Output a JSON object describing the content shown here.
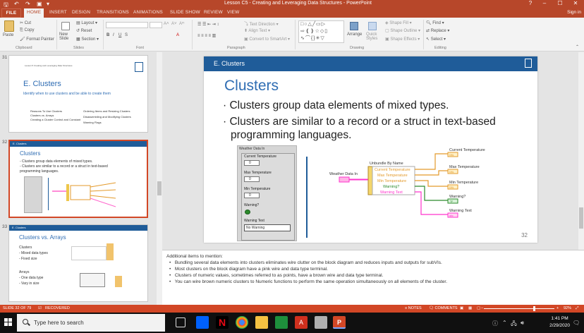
{
  "window": {
    "title": "Lesson C5 - Creating and Leveraging Data Structures - PowerPoint",
    "sign_in": "Sign in",
    "minimize": "–",
    "restore": "☐",
    "close": "✕",
    "help": "?"
  },
  "tabs": [
    "FILE",
    "HOME",
    "INSERT",
    "DESIGN",
    "TRANSITIONS",
    "ANIMATIONS",
    "SLIDE SHOW",
    "REVIEW",
    "VIEW"
  ],
  "ribbon": {
    "clipboard": {
      "paste": "Paste",
      "cut": "Cut",
      "copy": "Copy",
      "format_painter": "Format Painter",
      "label": "Clipboard"
    },
    "slides": {
      "new_slide": "New Slide",
      "layout": "Layout",
      "reset": "Reset",
      "section": "Section",
      "label": "Slides"
    },
    "font": {
      "label": "Font",
      "bold": "B",
      "italic": "I",
      "underline": "U",
      "strike": "S",
      "grow": "A˄",
      "shrink": "A˅",
      "clear": "Aᵐ",
      "color": "A"
    },
    "paragraph": {
      "text_direction": "Text Direction",
      "align_text": "Align Text",
      "smartart": "Convert to SmartArt",
      "label": "Paragraph"
    },
    "drawing": {
      "arrange": "Arrange",
      "quick_styles": "Quick Styles",
      "shape_fill": "Shape Fill",
      "shape_outline": "Shape Outline",
      "shape_effects": "Shape Effects",
      "label": "Drawing"
    },
    "editing": {
      "find": "Find",
      "replace": "Replace",
      "select": "Select",
      "label": "Editing"
    }
  },
  "thumbnails": [
    {
      "number": "31",
      "title": "E. Clusters",
      "subtitle": "Identify when to use clusters and be able to create them",
      "header": "Lesson 5 Creating and Leveraging Data Structures",
      "col1": [
        "Reasons To Use Clusters",
        "Clusters vs. Arrays",
        "Creating a Cluster Control and Constant"
      ],
      "col2": [
        "Ordering Items and Resizing Clusters",
        "Disassembling and Modifying Clusters",
        "Warning Flags"
      ]
    },
    {
      "number": "32",
      "bar": "E. Clusters",
      "title": "Clusters",
      "lines": [
        "- Clusters group data elements of mixed types.",
        "- Clusters are similar to a record or a struct in text-based",
        "  programming languages."
      ]
    },
    {
      "number": "33",
      "bar": "E. Clusters",
      "title": "Clusters vs. Arrays",
      "lines": [
        "Clusters",
        "- Mixed data types",
        "- Fixed size",
        "Arrays",
        "- One data type",
        "- Vary in size"
      ]
    }
  ],
  "slide": {
    "section_bar": "E. Clusters",
    "title": "Clusters",
    "bullets": [
      "Clusters group data elements of mixed types.",
      "Clusters are similar to a record or a struct in text-based programming languages."
    ],
    "page_number": "32",
    "front_panel": {
      "title": "Weather Data In",
      "current_temp_label": "Current Temperature",
      "max_temp_label": "Max Temperature",
      "min_temp_label": "Min Temperature",
      "warning_label": "Warning?",
      "warning_text_label": "Warning Text",
      "num_value": "0",
      "warning_text_value": "No Warning"
    },
    "block_diagram": {
      "input_label": "Weather Data In",
      "unbundle_label": "Unbundle By Name",
      "elements": [
        "Current Temperature",
        "Max Temperature",
        "Min Temperature",
        "Warning?",
        "Warning Text"
      ],
      "outputs": [
        "Current Temperature",
        "Max Temperature",
        "Min Temperature",
        "Warning?",
        "Warning Text"
      ],
      "dbl": "DBL",
      "tf": "TF",
      "abc": "abc"
    }
  },
  "notes": {
    "heading": "Additional items to mention:",
    "items": [
      "Bundling several data elements into clusters eliminates wire clutter on the block diagram and reduces inputs and outputs for subVIs.",
      "Most clusters on the block diagram have a pink wire and data type terminal.",
      "Clusters of numeric values, sometimes referred to as points, have a brown wire and data type terminal.",
      "You can wire brown numeric clusters to Numeric functions to perform the same operation simultaneously on all elements of the cluster."
    ]
  },
  "status": {
    "slide_of": "SLIDE 32 OF 79",
    "recovered": "RECOVERED",
    "notes": "NOTES",
    "comments": "COMMENTS",
    "zoom": "92%"
  },
  "taskbar": {
    "search_placeholder": "Type here to search",
    "time": "1:41 PM",
    "date": "2/29/2020"
  }
}
